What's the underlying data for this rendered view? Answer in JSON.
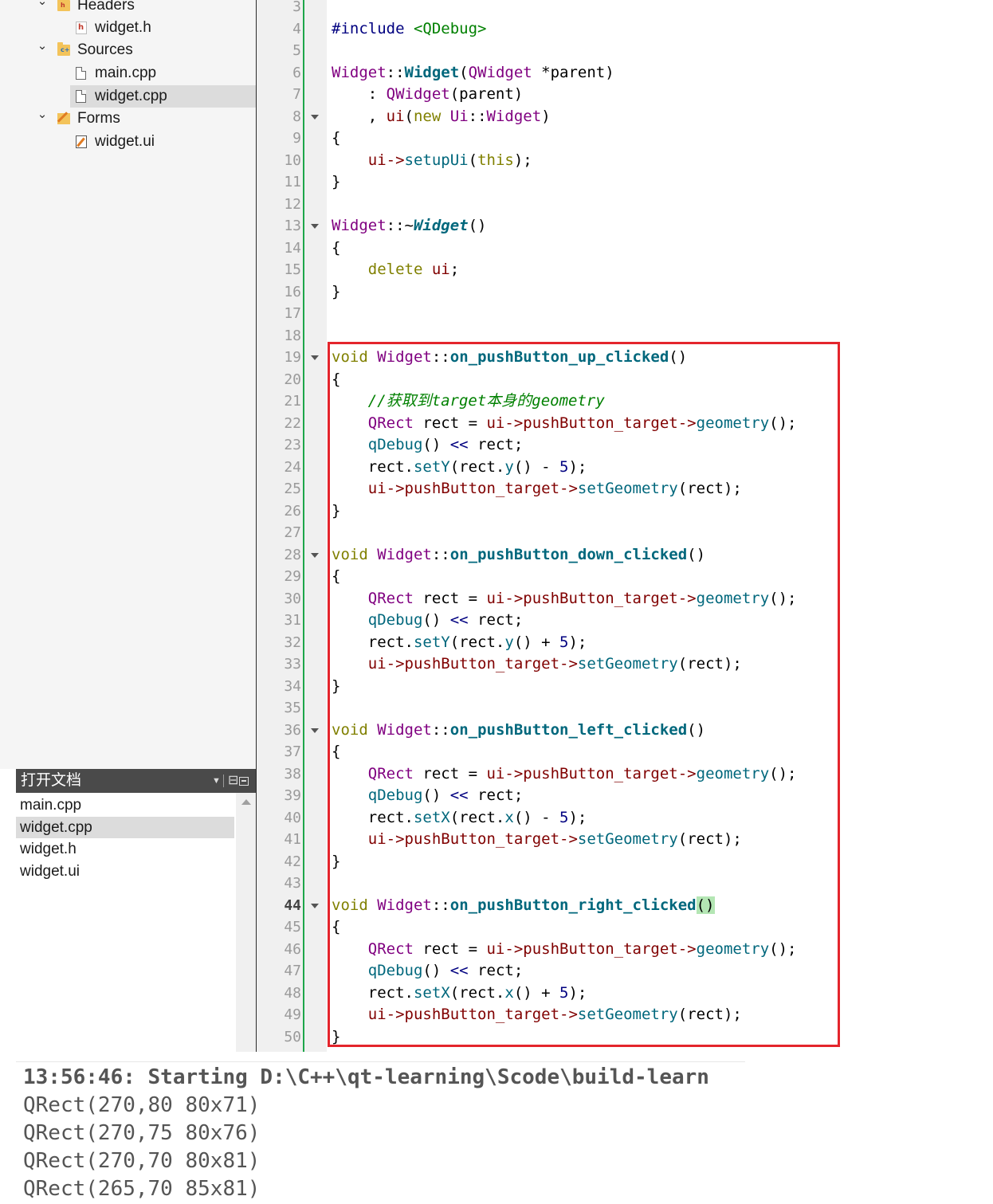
{
  "project_tree": [
    {
      "kind": "folder",
      "label": "Headers",
      "tag": "h",
      "expanded": true
    },
    {
      "kind": "hfile",
      "label": "widget.h"
    },
    {
      "kind": "folder",
      "label": "Sources",
      "tag": "c+",
      "expanded": true
    },
    {
      "kind": "cppfile",
      "label": "main.cpp"
    },
    {
      "kind": "cppfile",
      "label": "widget.cpp",
      "selected": true
    },
    {
      "kind": "forms",
      "label": "Forms",
      "expanded": true
    },
    {
      "kind": "uifile",
      "label": "widget.ui"
    }
  ],
  "open_documents": {
    "title": "打开文档",
    "items": [
      {
        "label": "main.cpp"
      },
      {
        "label": "widget.cpp",
        "selected": true
      },
      {
        "label": "widget.h"
      },
      {
        "label": "widget.ui"
      }
    ]
  },
  "editor": {
    "first_line": 3,
    "current_line": 44,
    "fold_lines": [
      8,
      13,
      19,
      28,
      36,
      44
    ],
    "lines": [
      [],
      [
        [
          "#include",
          "pp"
        ],
        [
          " "
        ],
        [
          "<QDebug>",
          "inc"
        ]
      ],
      [],
      [
        [
          "Widget",
          "cls"
        ],
        [
          "::"
        ],
        [
          "Widget",
          "fnb"
        ],
        [
          "("
        ],
        [
          "QWidget",
          "cls"
        ],
        [
          " *parent)"
        ]
      ],
      [
        [
          "    : "
        ],
        [
          "QWidget",
          "cls"
        ],
        [
          "(parent)"
        ]
      ],
      [
        [
          "    , "
        ],
        [
          "ui",
          "mem"
        ],
        [
          "("
        ],
        [
          "new",
          "kw"
        ],
        [
          " "
        ],
        [
          "Ui",
          "cls"
        ],
        [
          "::"
        ],
        [
          "Widget",
          "cls"
        ],
        [
          ")"
        ]
      ],
      [
        [
          "{"
        ]
      ],
      [
        [
          "    "
        ],
        [
          "ui",
          "mem"
        ],
        [
          "->",
          "ptr"
        ],
        [
          "setupUi",
          "fn"
        ],
        [
          "("
        ],
        [
          "this",
          "kw"
        ],
        [
          ");"
        ]
      ],
      [
        [
          "}"
        ]
      ],
      [],
      [
        [
          "Widget",
          "cls"
        ],
        [
          "::~"
        ],
        [
          "Widget",
          "dtor"
        ],
        [
          "()"
        ]
      ],
      [
        [
          "{"
        ]
      ],
      [
        [
          "    "
        ],
        [
          "delete",
          "kw"
        ],
        [
          " "
        ],
        [
          "ui",
          "mem"
        ],
        [
          ";"
        ]
      ],
      [
        [
          "}"
        ]
      ],
      [],
      [],
      [
        [
          "void",
          "kw"
        ],
        [
          " "
        ],
        [
          "Widget",
          "cls"
        ],
        [
          "::"
        ],
        [
          "on_pushButton_up_clicked",
          "fnb"
        ],
        [
          "()"
        ]
      ],
      [
        [
          "{"
        ]
      ],
      [
        [
          "    "
        ],
        [
          "//获取到target本身的geometry",
          "com"
        ]
      ],
      [
        [
          "    "
        ],
        [
          "QRect",
          "cls"
        ],
        [
          " rect = "
        ],
        [
          "ui",
          "mem"
        ],
        [
          "->",
          "ptr"
        ],
        [
          "pushButton_target",
          "mem"
        ],
        [
          "->",
          "ptr"
        ],
        [
          "geometry",
          "fn"
        ],
        [
          "();"
        ]
      ],
      [
        [
          "    "
        ],
        [
          "qDebug",
          "fn"
        ],
        [
          "() "
        ],
        [
          "<<",
          "num"
        ],
        [
          " rect;"
        ]
      ],
      [
        [
          "    rect."
        ],
        [
          "setY",
          "fn"
        ],
        [
          "(rect."
        ],
        [
          "y",
          "fn"
        ],
        [
          "() - "
        ],
        [
          "5",
          "num"
        ],
        [
          ");"
        ]
      ],
      [
        [
          "    "
        ],
        [
          "ui",
          "mem"
        ],
        [
          "->",
          "ptr"
        ],
        [
          "pushButton_target",
          "mem"
        ],
        [
          "->",
          "ptr"
        ],
        [
          "setGeometry",
          "fn"
        ],
        [
          "(rect);"
        ]
      ],
      [
        [
          "}"
        ]
      ],
      [],
      [
        [
          "void",
          "kw"
        ],
        [
          " "
        ],
        [
          "Widget",
          "cls"
        ],
        [
          "::"
        ],
        [
          "on_pushButton_down_clicked",
          "fnb"
        ],
        [
          "()"
        ]
      ],
      [
        [
          "{"
        ]
      ],
      [
        [
          "    "
        ],
        [
          "QRect",
          "cls"
        ],
        [
          " rect = "
        ],
        [
          "ui",
          "mem"
        ],
        [
          "->",
          "ptr"
        ],
        [
          "pushButton_target",
          "mem"
        ],
        [
          "->",
          "ptr"
        ],
        [
          "geometry",
          "fn"
        ],
        [
          "();"
        ]
      ],
      [
        [
          "    "
        ],
        [
          "qDebug",
          "fn"
        ],
        [
          "() "
        ],
        [
          "<<",
          "num"
        ],
        [
          " rect;"
        ]
      ],
      [
        [
          "    rect."
        ],
        [
          "setY",
          "fn"
        ],
        [
          "(rect."
        ],
        [
          "y",
          "fn"
        ],
        [
          "() + "
        ],
        [
          "5",
          "num"
        ],
        [
          ");"
        ]
      ],
      [
        [
          "    "
        ],
        [
          "ui",
          "mem"
        ],
        [
          "->",
          "ptr"
        ],
        [
          "pushButton_target",
          "mem"
        ],
        [
          "->",
          "ptr"
        ],
        [
          "setGeometry",
          "fn"
        ],
        [
          "(rect);"
        ]
      ],
      [
        [
          "}"
        ]
      ],
      [],
      [
        [
          "void",
          "kw"
        ],
        [
          " "
        ],
        [
          "Widget",
          "cls"
        ],
        [
          "::"
        ],
        [
          "on_pushButton_left_clicked",
          "fnb"
        ],
        [
          "()"
        ]
      ],
      [
        [
          "{"
        ]
      ],
      [
        [
          "    "
        ],
        [
          "QRect",
          "cls"
        ],
        [
          " rect = "
        ],
        [
          "ui",
          "mem"
        ],
        [
          "->",
          "ptr"
        ],
        [
          "pushButton_target",
          "mem"
        ],
        [
          "->",
          "ptr"
        ],
        [
          "geometry",
          "fn"
        ],
        [
          "();"
        ]
      ],
      [
        [
          "    "
        ],
        [
          "qDebug",
          "fn"
        ],
        [
          "() "
        ],
        [
          "<<",
          "num"
        ],
        [
          " rect;"
        ]
      ],
      [
        [
          "    rect."
        ],
        [
          "setX",
          "fn"
        ],
        [
          "(rect."
        ],
        [
          "x",
          "fn"
        ],
        [
          "() - "
        ],
        [
          "5",
          "num"
        ],
        [
          ");"
        ]
      ],
      [
        [
          "    "
        ],
        [
          "ui",
          "mem"
        ],
        [
          "->",
          "ptr"
        ],
        [
          "pushButton_target",
          "mem"
        ],
        [
          "->",
          "ptr"
        ],
        [
          "setGeometry",
          "fn"
        ],
        [
          "(rect);"
        ]
      ],
      [
        [
          "}"
        ]
      ],
      [],
      [
        [
          "void",
          "kw"
        ],
        [
          " "
        ],
        [
          "Widget",
          "cls"
        ],
        [
          "::"
        ],
        [
          "on_pushButton_right_clicked",
          "fnb"
        ],
        [
          "()",
          "hlp"
        ]
      ],
      [
        [
          "{"
        ]
      ],
      [
        [
          "    "
        ],
        [
          "QRect",
          "cls"
        ],
        [
          " rect = "
        ],
        [
          "ui",
          "mem"
        ],
        [
          "->",
          "ptr"
        ],
        [
          "pushButton_target",
          "mem"
        ],
        [
          "->",
          "ptr"
        ],
        [
          "geometry",
          "fn"
        ],
        [
          "();"
        ]
      ],
      [
        [
          "    "
        ],
        [
          "qDebug",
          "fn"
        ],
        [
          "() "
        ],
        [
          "<<",
          "num"
        ],
        [
          " rect;"
        ]
      ],
      [
        [
          "    rect."
        ],
        [
          "setX",
          "fn"
        ],
        [
          "(rect."
        ],
        [
          "x",
          "fn"
        ],
        [
          "() + "
        ],
        [
          "5",
          "num"
        ],
        [
          ");"
        ]
      ],
      [
        [
          "    "
        ],
        [
          "ui",
          "mem"
        ],
        [
          "->",
          "ptr"
        ],
        [
          "pushButton_target",
          "mem"
        ],
        [
          "->",
          "ptr"
        ],
        [
          "setGeometry",
          "fn"
        ],
        [
          "(rect);"
        ]
      ],
      [
        [
          "}"
        ]
      ]
    ]
  },
  "output": {
    "start_line": "13:56:46: Starting D:\\C++\\qt-learning\\Scode\\build-learn",
    "lines": [
      "QRect(270,80 80x71)",
      "QRect(270,75 80x76)",
      "QRect(270,70 80x81)",
      "QRect(265,70 85x81)"
    ]
  },
  "colors": {
    "highlight_box": "#e4252c",
    "change_bar": "#1ea64a",
    "open_docs_header": "#4a4a4a"
  }
}
